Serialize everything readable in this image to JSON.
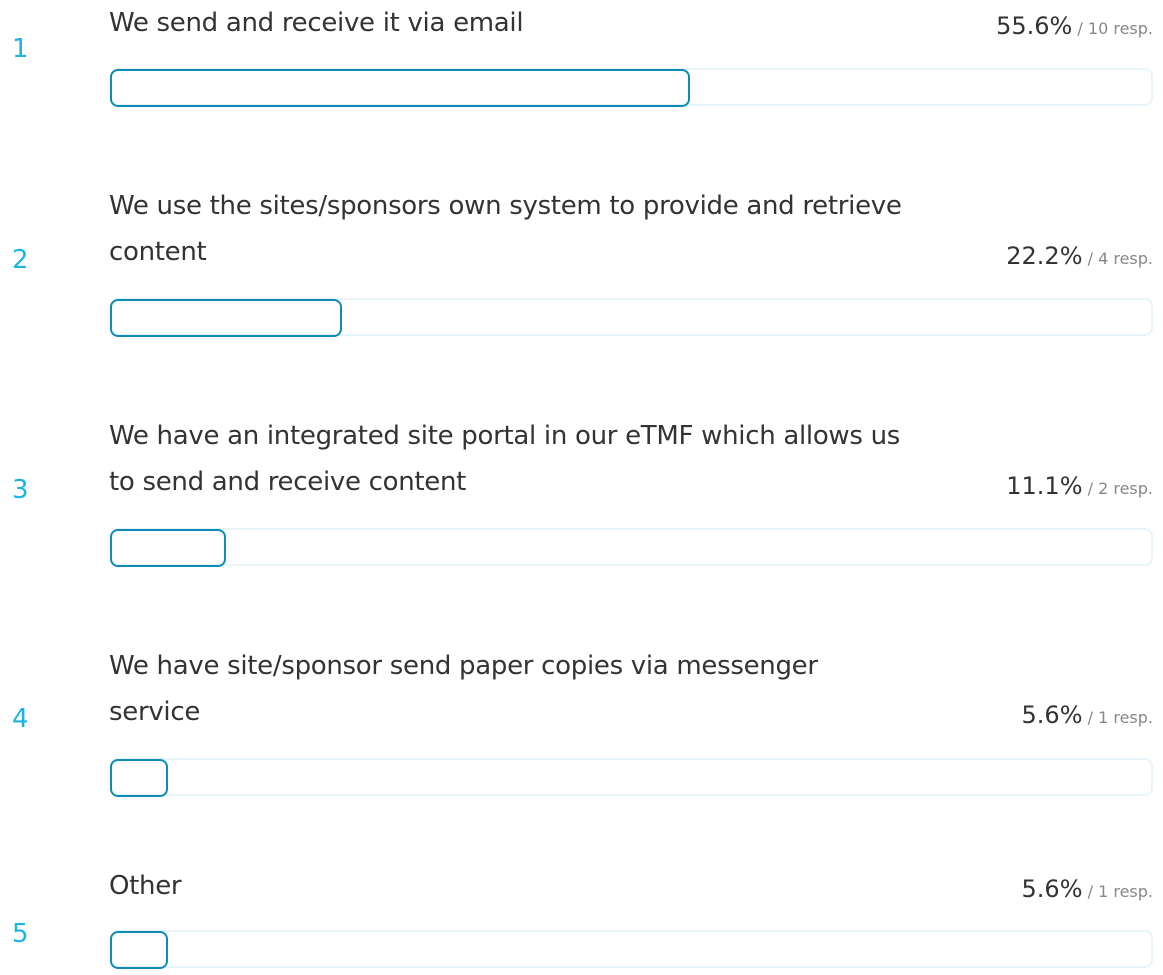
{
  "chart_data": {
    "type": "bar",
    "orientation": "horizontal",
    "title": "",
    "xlabel": "",
    "ylabel": "",
    "xlim": [
      0,
      100
    ],
    "categories": [
      "We send and receive it via email",
      "We use the sites/sponsors own system to provide and retrieve content",
      "We have an integrated site portal in our eTMF which allows us to send and receive content",
      "We have site/sponsor send paper copies via messenger service",
      "Other"
    ],
    "values": [
      55.6,
      22.2,
      11.1,
      5.6,
      5.6
    ],
    "responses": [
      10,
      4,
      2,
      1,
      1
    ]
  },
  "rows": [
    {
      "rank": "1",
      "label": "We send and receive it via email",
      "percent_text": "55.6%",
      "resp_text": "/ 10 resp."
    },
    {
      "rank": "2",
      "label": "We use the sites/sponsors own system to provide and retrieve content",
      "percent_text": "22.2%",
      "resp_text": "/ 4 resp."
    },
    {
      "rank": "3",
      "label": "We have an integrated site portal in our eTMF which allows us to send and receive content",
      "percent_text": "11.1%",
      "resp_text": "/ 2 resp."
    },
    {
      "rank": "4",
      "label": "We have site/sponsor send paper copies via messenger service",
      "percent_text": "5.6%",
      "resp_text": "/ 1 resp."
    },
    {
      "rank": "5",
      "label": "Other",
      "percent_text": "5.6%",
      "resp_text": "/ 1 resp."
    }
  ],
  "colors": {
    "rank": "#1cb4e3",
    "bar_outline": "#0e8cb8",
    "track": "#e8f3f7"
  }
}
